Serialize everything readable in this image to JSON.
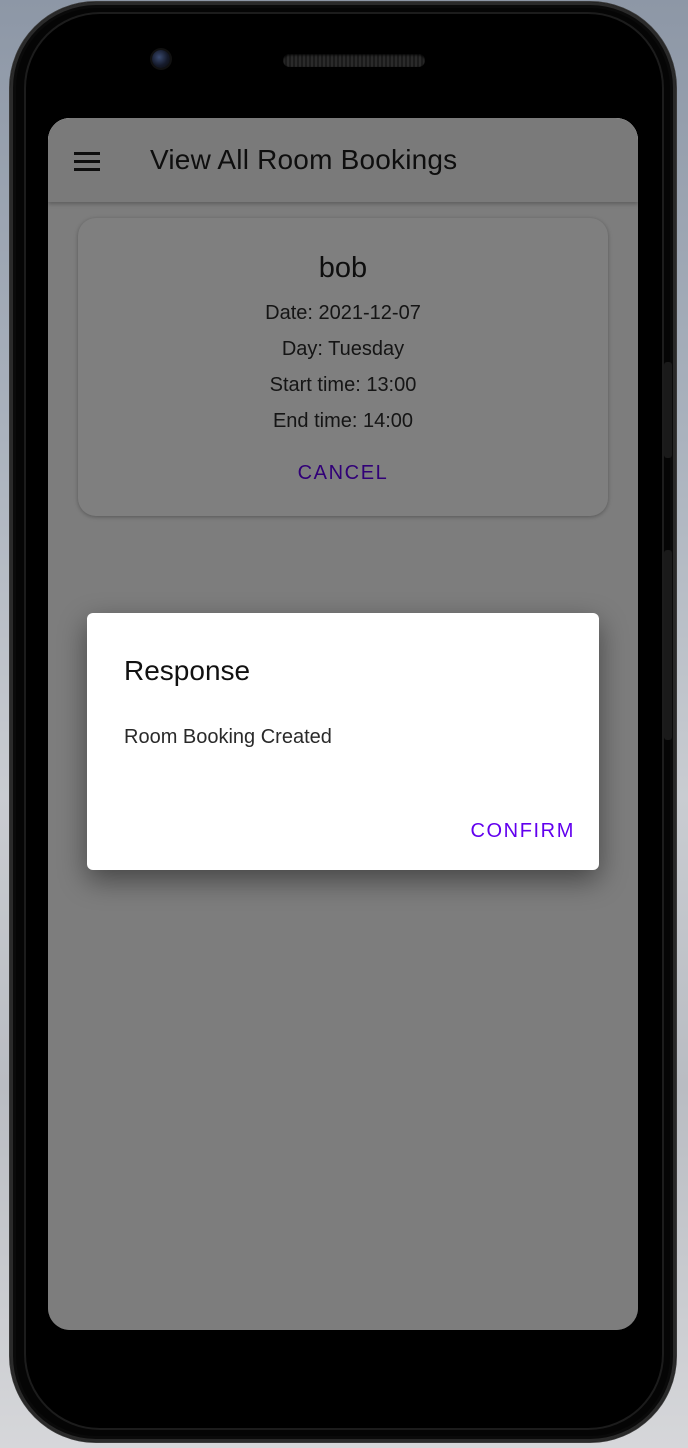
{
  "appbar": {
    "title": "View All Room Bookings"
  },
  "booking": {
    "name": "bob",
    "date": "Date: 2021-12-07",
    "day": "Day: Tuesday",
    "start": "Start time: 13:00",
    "end": "End time: 14:00",
    "cancel_label": "CANCEL"
  },
  "dialog": {
    "title": "Response",
    "message": "Room Booking Created",
    "confirm_label": "CONFIRM"
  },
  "colors": {
    "accent": "#6200ee",
    "appbar_bg": "#f5f5f5",
    "scrim": "rgba(0,0,0,0.5)"
  },
  "icons": {
    "menu": "hamburger-menu-icon"
  }
}
